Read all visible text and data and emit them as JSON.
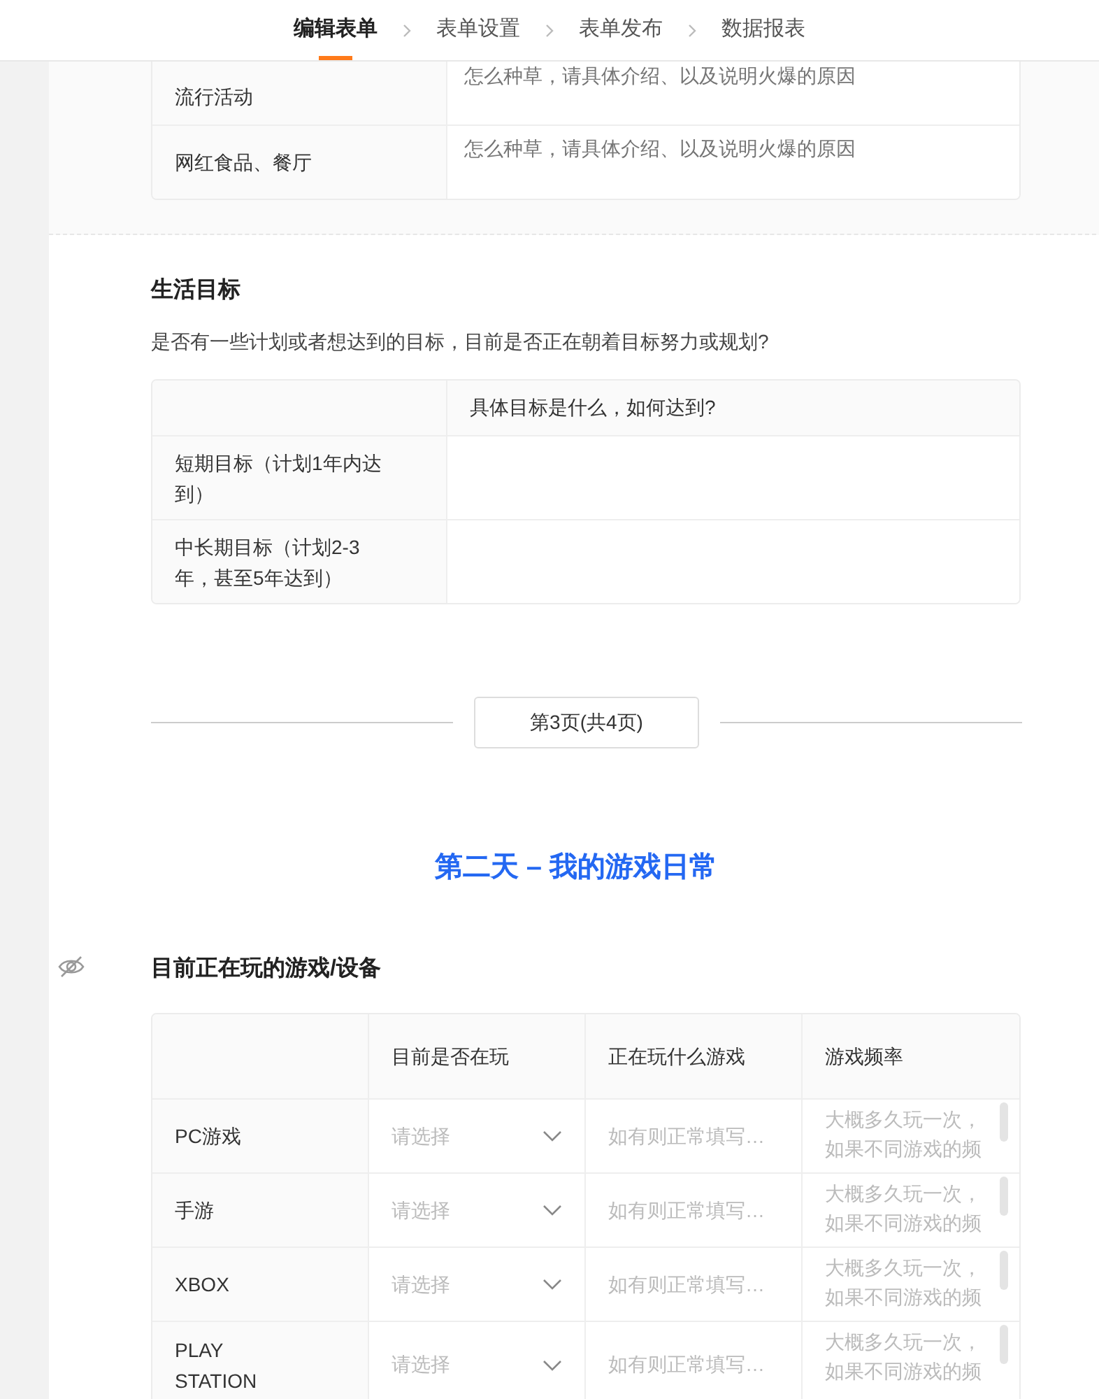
{
  "steps": [
    {
      "label": "编辑表单",
      "selected": true
    },
    {
      "label": "表单设置",
      "selected": false
    },
    {
      "label": "表单发布",
      "selected": false
    },
    {
      "label": "数据报表",
      "selected": false
    }
  ],
  "popular_block": {
    "rows": [
      {
        "label": "流行活动",
        "placeholder": "怎么种草，请具体介绍、以及说明火爆的原因"
      },
      {
        "label": "网红食品、餐厅",
        "placeholder": "怎么种草，请具体介绍、以及说明火爆的原因"
      }
    ]
  },
  "goals_block": {
    "title": "生活目标",
    "description": "是否有一些计划或者想达到的目标，目前是否正在朝着目标努力或规划?",
    "column_header": "具体目标是什么，如何达到?",
    "rows": [
      {
        "label": "短期目标（计划1年内达到）"
      },
      {
        "label": "中长期目标（计划2-3年，甚至5年达到）"
      }
    ]
  },
  "page_break": {
    "label": "第3页(共4页)"
  },
  "day_title": "第二天 – 我的游戏日常",
  "games_block": {
    "title": "目前正在玩的游戏/设备",
    "hidden": true,
    "columns": [
      "目前是否在玩",
      "正在玩什么游戏",
      "游戏频率"
    ],
    "rows": [
      {
        "label": "PC游戏",
        "select_placeholder": "请选择",
        "text_placeholder": "如有则正常填写…",
        "frequency_placeholder": "大概多久玩一次，如果不同游戏的频"
      },
      {
        "label": "手游",
        "select_placeholder": "请选择",
        "text_placeholder": "如有则正常填写…",
        "frequency_placeholder": "大概多久玩一次，如果不同游戏的频"
      },
      {
        "label": "XBOX",
        "select_placeholder": "请选择",
        "text_placeholder": "如有则正常填写…",
        "frequency_placeholder": "大概多久玩一次，如果不同游戏的频"
      },
      {
        "label": "PLAY STATION",
        "select_placeholder": "请选择",
        "text_placeholder": "如有则正常填写…",
        "frequency_placeholder": "大概多久玩一次，如果不同游戏的频"
      }
    ]
  }
}
